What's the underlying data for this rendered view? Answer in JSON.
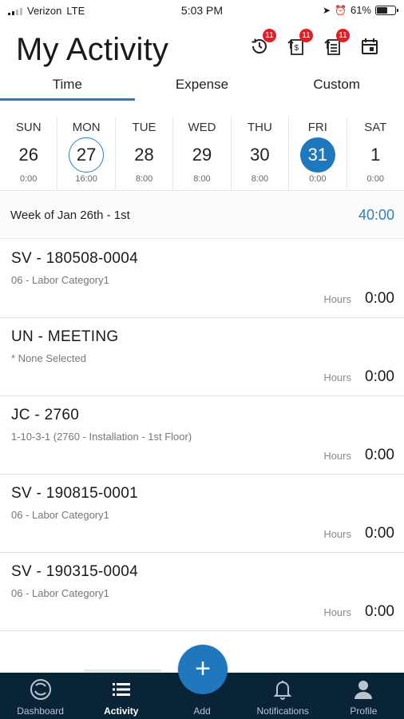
{
  "status_bar": {
    "carrier": "Verizon",
    "network": "LTE",
    "time": "5:03 PM",
    "battery": "61%",
    "battery_level": 0.61
  },
  "header": {
    "title": "My Activity",
    "icons": [
      {
        "name": "time-approval-icon",
        "badge": "11"
      },
      {
        "name": "expense-approval-icon",
        "badge": "11"
      },
      {
        "name": "list-approval-icon",
        "badge": "11"
      },
      {
        "name": "calendar-icon",
        "badge": ""
      }
    ]
  },
  "tabs": [
    {
      "label": "Time",
      "active": true
    },
    {
      "label": "Expense",
      "active": false
    },
    {
      "label": "Custom",
      "active": false
    }
  ],
  "week_days": [
    {
      "name": "SUN",
      "date": "26",
      "hours": "0:00"
    },
    {
      "name": "MON",
      "date": "27",
      "hours": "16:00",
      "today": true
    },
    {
      "name": "TUE",
      "date": "28",
      "hours": "8:00"
    },
    {
      "name": "WED",
      "date": "29",
      "hours": "8:00"
    },
    {
      "name": "THU",
      "date": "30",
      "hours": "8:00"
    },
    {
      "name": "FRI",
      "date": "31",
      "hours": "0:00",
      "selected": true
    },
    {
      "name": "SAT",
      "date": "1",
      "hours": "0:00"
    }
  ],
  "week_summary": {
    "label": "Week of Jan 26th - 1st",
    "total": "40:00"
  },
  "entries": [
    {
      "code": "SV - 180508-0004",
      "sub": "06 - Labor Category1",
      "hours_label": "Hours",
      "hours": "0:00"
    },
    {
      "code": "UN - MEETING",
      "sub": "* None Selected",
      "hours_label": "Hours",
      "hours": "0:00"
    },
    {
      "code": "JC - 2760",
      "sub": "1-10-3-1 (2760 - Installation - 1st Floor)",
      "hours_label": "Hours",
      "hours": "0:00"
    },
    {
      "code": "SV - 190815-0001",
      "sub": "06 - Labor Category1",
      "hours_label": "Hours",
      "hours": "0:00"
    },
    {
      "code": "SV - 190315-0004",
      "sub": "06 - Labor Category1",
      "hours_label": "Hours",
      "hours": "0:00"
    }
  ],
  "bottom_nav": [
    {
      "label": "Dashboard",
      "icon": "dashboard-icon",
      "active": false
    },
    {
      "label": "Activity",
      "icon": "list-icon",
      "active": true
    },
    {
      "label": "Add",
      "icon": "plus-icon",
      "active": false
    },
    {
      "label": "Notifications",
      "icon": "bell-icon",
      "active": false
    },
    {
      "label": "Profile",
      "icon": "person-icon",
      "active": false
    }
  ],
  "fab": {
    "symbol": "+"
  },
  "colors": {
    "accent": "#1f78bd",
    "badge": "#e21d25",
    "nav_bg": "#0a2437"
  }
}
